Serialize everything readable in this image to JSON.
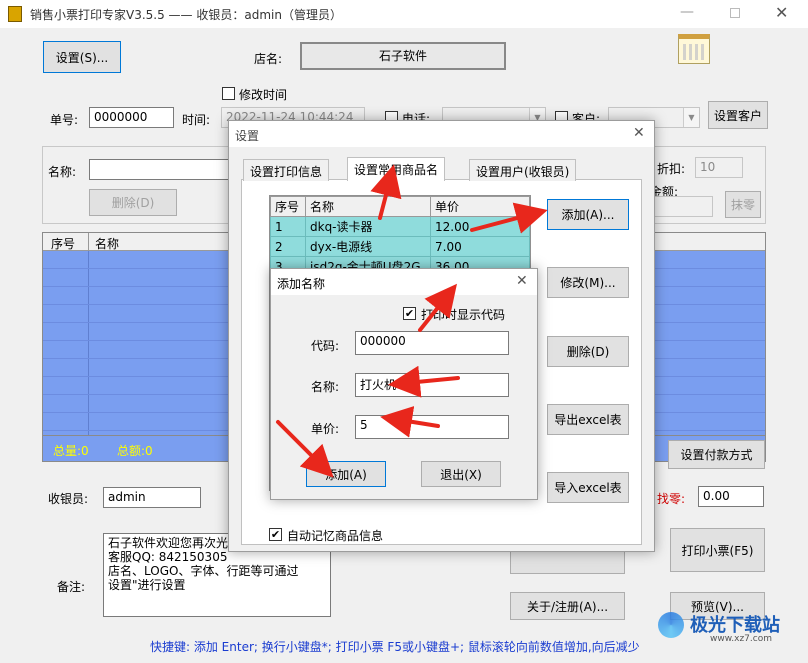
{
  "titlebar": {
    "title": "销售小票打印专家V3.5.5 —— 收银员：admin（管理员）"
  },
  "main": {
    "settings_button": "设置(S)...",
    "store_label": "店名:",
    "store_value": "石子软件",
    "modify_time_label": "修改时间",
    "order_no_label": "单号:",
    "order_no_value": "0000000",
    "time_label": "时间:",
    "time_value": "2022-11-24 10:44:24",
    "phone_label": "电话:",
    "customer_label": "客户:",
    "set_customer_button": "设置客户",
    "name_label": "名称:",
    "delete_button": "删除(D)",
    "discount_label": "折扣:",
    "discount_value": "10",
    "amount_label": "金额:",
    "wipe_button": "抹零",
    "grid_headers": [
      "序号",
      "名称"
    ],
    "total_qty": "总量:0",
    "total_amount": "总额:0",
    "payment_button": "设置付款方式",
    "cashier_label": "收银员:",
    "cashier_value": "admin",
    "change_label": "找零:",
    "change_value": "0.00",
    "remark_label": "备注:",
    "remark_text": "石子软件欢迎您再次光临\n客服QQ: 842150305\n店名、LOGO、字体、行距等可通过\n设置\"进行设置",
    "print_button": "打印小票(F5)",
    "about_button": "关于/注册(A)...",
    "preview_button": "预览(V)...",
    "status_text": "快捷键: 添加 Enter; 换行小键盘*; 打印小票 F5或小键盘+; 鼠标滚轮向前数值增加,向后减少"
  },
  "settings_dialog": {
    "title": "设置",
    "tabs": [
      "设置打印信息",
      "设置常用商品名",
      "设置用户(收银员)"
    ],
    "columns": [
      "序号",
      "名称",
      "单价"
    ],
    "rows": [
      {
        "no": "1",
        "name": "dkq-读卡器",
        "price": "12.00"
      },
      {
        "no": "2",
        "name": "dyx-电源线",
        "price": "7.00"
      },
      {
        "no": "3",
        "name": "jsd2g-金士顿U盘2G",
        "price": "36.00"
      }
    ],
    "add_button": "添加(A)...",
    "modify_button": "修改(M)...",
    "delete_button": "删除(D)",
    "export_button": "导出excel表",
    "import_button": "导入excel表",
    "remember_label": "自动记忆商品信息"
  },
  "add_name_dialog": {
    "title": "添加名称",
    "show_code_label": "打印时显示代码",
    "code_label": "代码:",
    "code_value": "000000",
    "name_label": "名称:",
    "name_value": "打火机",
    "price_label": "单价:",
    "price_value": "5",
    "add_button": "添加(A)",
    "exit_button": "退出(X)"
  },
  "watermark": {
    "text": "极光下载站",
    "url": "www.xz7.com"
  },
  "colors": {
    "grid_blue": "#7a9ef0",
    "row_cyan": "#8fdcdc",
    "arrow_red": "#e8271c",
    "total_text": "#ffff00"
  }
}
